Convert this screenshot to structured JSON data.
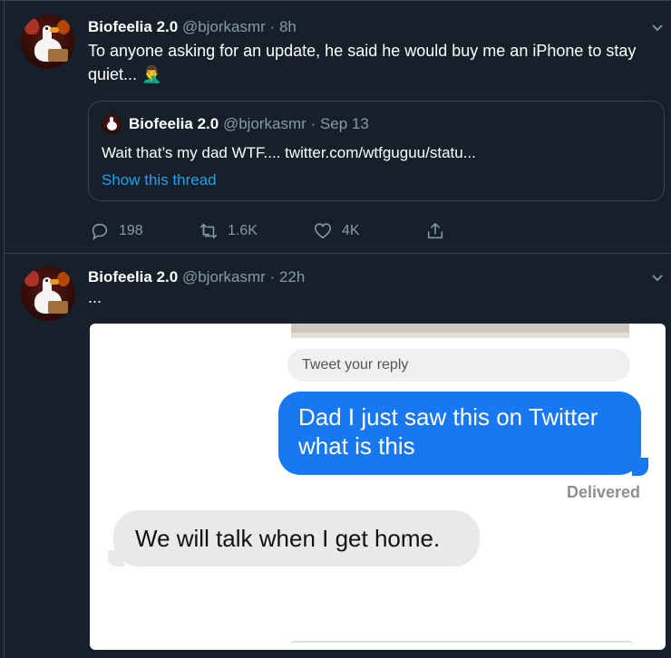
{
  "tweets": [
    {
      "name": "Biofeelia 2.0",
      "handle": "@bjorkasmr",
      "time": "· 8h",
      "text": "To anyone asking for an update, he said he would buy me an iPhone to stay",
      "text_line2": "quiet... 🤦‍♂️",
      "quoted": {
        "name": "Biofeelia 2.0",
        "handle": "@bjorkasmr",
        "time": "· Sep 13",
        "text": "Wait that’s my dad WTF.... twitter.com/wtfguguu/statu...",
        "link": "Show this thread"
      },
      "actions": {
        "replies": "198",
        "retweets": "1.6K",
        "likes": "4K"
      }
    },
    {
      "name": "Biofeelia 2.0",
      "handle": "@bjorkasmr",
      "time": "· 22h",
      "text": "...",
      "media": {
        "reply_placeholder": "Tweet your reply",
        "sent_message": "Dad I just saw this on Twitter what is this",
        "status": "Delivered",
        "received_message": "We will talk when I get home."
      }
    }
  ],
  "icons": {
    "reply": "reply-icon",
    "retweet": "retweet-icon",
    "like": "heart-icon",
    "share": "share-icon",
    "more": "chevron-down-icon"
  },
  "colors": {
    "background": "#15202b",
    "border": "#38444d",
    "muted": "#8899a6",
    "link": "#1da1f2",
    "imessage_blue": "#1878f2",
    "imessage_gray": "#e9e9eb"
  }
}
